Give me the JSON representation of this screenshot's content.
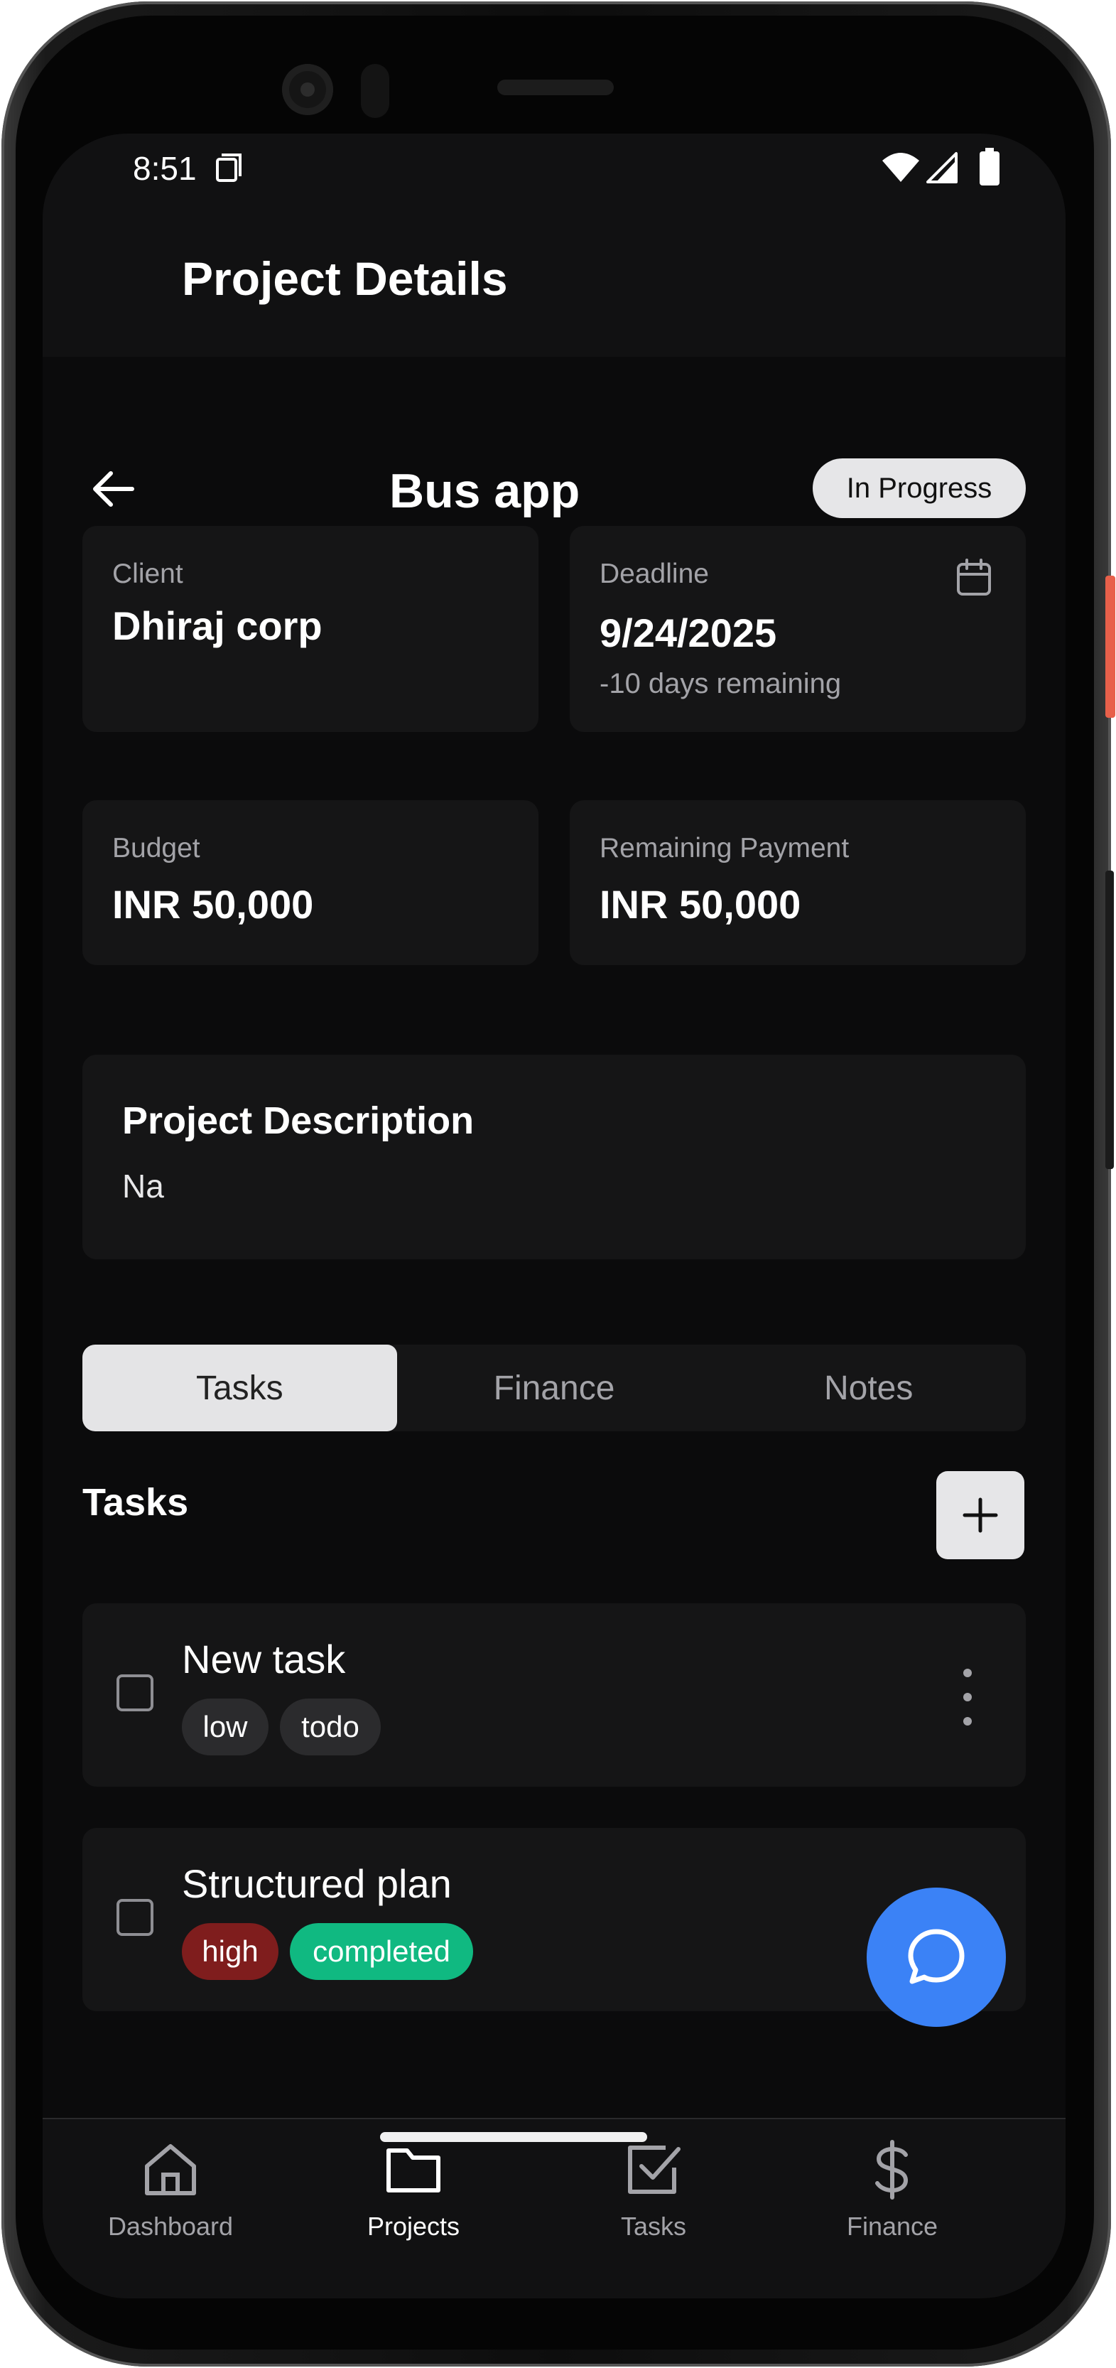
{
  "status_bar": {
    "time": "8:51"
  },
  "app_bar": {
    "title": "Project Details"
  },
  "project": {
    "name": "Bus app",
    "status": "In Progress"
  },
  "info_cards": {
    "client": {
      "label": "Client",
      "value": "Dhiraj corp"
    },
    "deadline": {
      "label": "Deadline",
      "value": "9/24/2025",
      "remaining": "-10 days remaining"
    },
    "budget": {
      "label": "Budget",
      "value": "INR 50,000"
    },
    "remaining_payment": {
      "label": "Remaining Payment",
      "value": "INR 50,000"
    }
  },
  "description": {
    "title": "Project Description",
    "body": "Na"
  },
  "tabs": [
    {
      "label": "Tasks",
      "active": true
    },
    {
      "label": "Finance",
      "active": false
    },
    {
      "label": "Notes",
      "active": false
    }
  ],
  "tasks_section": {
    "title": "Tasks",
    "items": [
      {
        "title": "New task",
        "priority": "low",
        "status": "todo",
        "checked": false
      },
      {
        "title": "Structured plan",
        "priority": "high",
        "status": "completed",
        "checked": false
      }
    ]
  },
  "colors": {
    "priority_low": "#2b2b2d",
    "status_todo": "#2b2b2d",
    "priority_high": "#7f1d1d",
    "status_completed": "#10b981",
    "fab": "#3b82f6"
  },
  "bottom_nav": [
    {
      "label": "Dashboard",
      "icon": "home-icon",
      "active": false
    },
    {
      "label": "Projects",
      "icon": "folder-icon",
      "active": true
    },
    {
      "label": "Tasks",
      "icon": "checkbox-icon",
      "active": false
    },
    {
      "label": "Finance",
      "icon": "dollar-icon",
      "active": false
    }
  ]
}
